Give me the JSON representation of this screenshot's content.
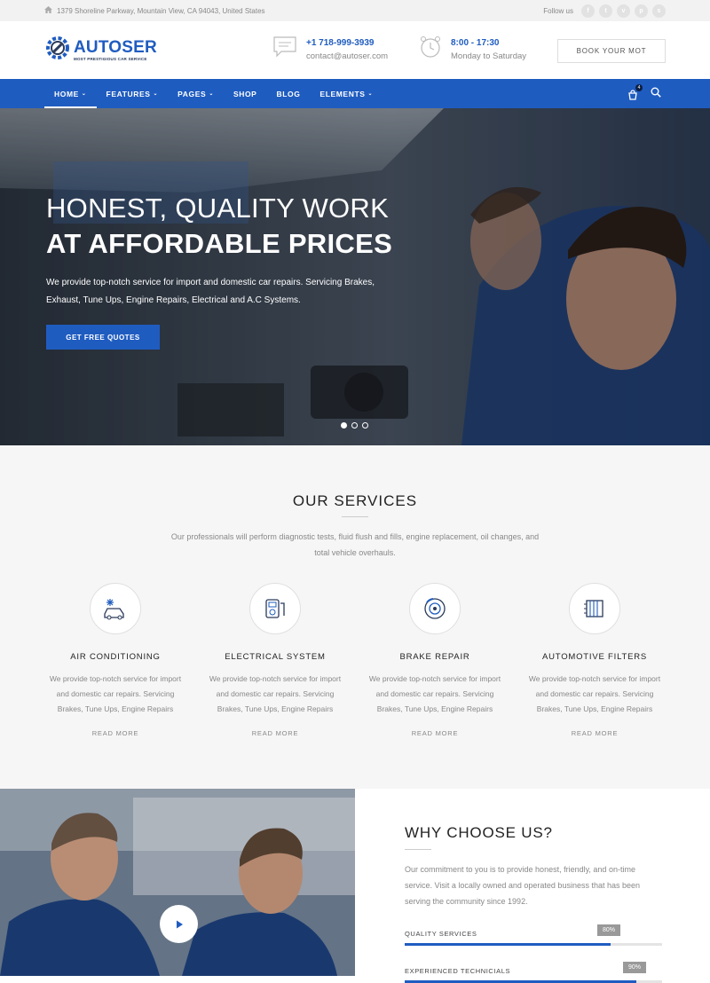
{
  "topbar": {
    "address": "1379 Shoreline Parkway, Mountain View, CA 94043, United States",
    "follow_label": "Follow us",
    "social": [
      {
        "icon": "facebook-icon",
        "glyph": "f"
      },
      {
        "icon": "twitter-icon",
        "glyph": "t"
      },
      {
        "icon": "vimeo-icon",
        "glyph": "v"
      },
      {
        "icon": "pinterest-icon",
        "glyph": "p"
      },
      {
        "icon": "skype-icon",
        "glyph": "s"
      }
    ]
  },
  "header": {
    "logo_name": "AUTOSER",
    "logo_tagline": "MOST PRESTIGIOUS CAR SERVICE",
    "phone": "+1 718-999-3939",
    "email": "contact@autoser.com",
    "hours": "8:00 - 17:30",
    "days": "Monday to Saturday",
    "book_button": "BOOK YOUR MOT"
  },
  "nav": {
    "items": [
      {
        "label": "HOME",
        "dropdown": true,
        "active": true
      },
      {
        "label": "FEATURES",
        "dropdown": true
      },
      {
        "label": "PAGES",
        "dropdown": true
      },
      {
        "label": "SHOP",
        "dropdown": false
      },
      {
        "label": "BLOG",
        "dropdown": false
      },
      {
        "label": "ELEMENTS",
        "dropdown": true
      }
    ],
    "cart_count": "4"
  },
  "hero": {
    "title_line1": "HONEST, QUALITY WORK",
    "title_line2": "AT AFFORDABLE PRICES",
    "text": "We provide top-notch service for import and domestic car repairs. Servicing Brakes, Exhaust, Tune Ups, Engine Repairs, Electrical and A.C Systems.",
    "button": "GET FREE QUOTES",
    "slides": 3,
    "active_slide": 0
  },
  "services": {
    "title": "OUR SERVICES",
    "intro": "Our professionals will perform diagnostic tests, fluid flush and fills, engine replacement, oil changes, and total vehicle overhauls.",
    "items": [
      {
        "icon": "air-conditioning-icon",
        "title": "AIR CONDITIONING",
        "text": "We provide top-notch service for import and domestic car repairs. Servicing Brakes, Tune Ups, Engine Repairs",
        "link": "READ MORE"
      },
      {
        "icon": "electrical-system-icon",
        "title": "ELECTRICAL SYSTEM",
        "text": "We provide top-notch service for import and domestic car repairs. Servicing Brakes, Tune Ups, Engine Repairs",
        "link": "READ MORE"
      },
      {
        "icon": "brake-repair-icon",
        "title": "BRAKE REPAIR",
        "text": "We provide top-notch service for import and domestic car repairs. Servicing Brakes, Tune Ups, Engine Repairs",
        "link": "READ MORE"
      },
      {
        "icon": "automotive-filters-icon",
        "title": "AUTOMOTIVE FILTERS",
        "text": "We provide top-notch service for import and domestic car repairs. Servicing Brakes, Tune Ups, Engine Repairs",
        "link": "READ MORE"
      }
    ]
  },
  "why": {
    "title": "WHY CHOOSE US?",
    "text": "Our commitment to you is to provide honest, friendly, and on-time service. Visit a locally owned and operated business that has been serving the community since 1992.",
    "skills": [
      {
        "label": "QUALITY SERVICES",
        "percent": 80,
        "percent_label": "80%"
      },
      {
        "label": "EXPERIENCED TECHNICIALS",
        "percent": 90,
        "percent_label": "90%"
      }
    ]
  },
  "colors": {
    "brand": "#1f5cc0",
    "nav": "#1f5cc0",
    "dark": "#0c1f44"
  }
}
